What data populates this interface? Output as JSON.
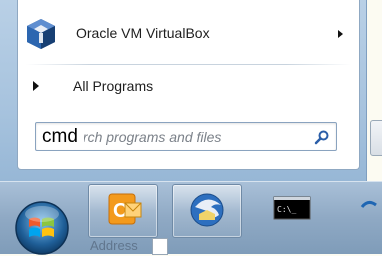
{
  "start_menu": {
    "programs": [
      {
        "label": "Oracle VM VirtualBox",
        "icon": "virtualbox-icon",
        "has_submenu": true
      }
    ],
    "all_programs_label": "All Programs"
  },
  "search": {
    "typed_text": "cmd",
    "placeholder_visible": "Search programs and files"
  },
  "taskbar": {
    "start_button": "windows-orb-icon",
    "pinned": [
      {
        "name": "outlook",
        "icon": "outlook-icon"
      },
      {
        "name": "thunderbird",
        "icon": "thunderbird-icon"
      },
      {
        "name": "command-prompt",
        "icon": "cmd-icon",
        "text": "C:\\_"
      }
    ],
    "address_label": "Address"
  },
  "colors": {
    "taskbar": "#8fa9c4",
    "menu_frame": "#a7c3de",
    "panel": "#ffffff",
    "accent_orange": "#f39a1d"
  }
}
